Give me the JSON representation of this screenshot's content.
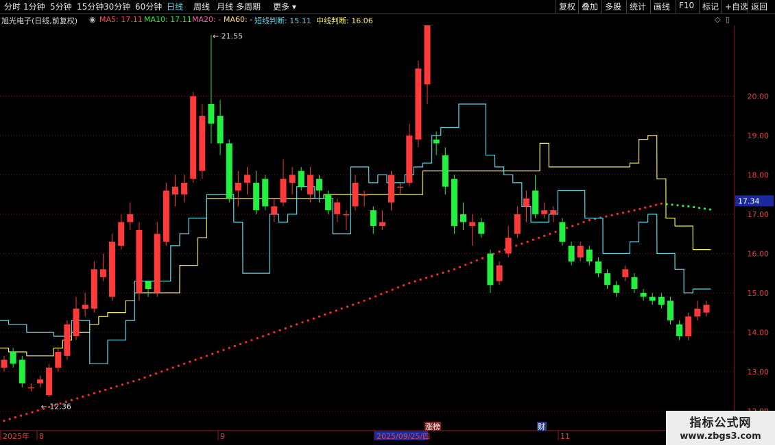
{
  "toolbar": {
    "left": [
      "分时",
      "1分钟",
      "5分钟",
      "15分钟",
      "30分钟",
      "60分钟",
      "日线",
      "周线",
      "月线",
      "多周期",
      "更多"
    ],
    "active": "日线",
    "right": [
      "复权",
      "叠加",
      "多股",
      "统计",
      "画线",
      "F10",
      "标记",
      "+自选",
      "返回"
    ]
  },
  "info": {
    "stock": "旭光电子(日线,前复权)",
    "ma5": "MA5: 17.11",
    "ma10": "MA10: 17.11",
    "ma20": "MA20: -",
    "ma60": "MA60: -",
    "short": "短线判断: 15.11",
    "mid": "中线判断: 16.06"
  },
  "colors": {
    "up": "#ff3a3a",
    "down": "#21f03e",
    "cyan": "#5fd9e6",
    "yellow": "#f5ee55",
    "dot": "#ff2a2a",
    "grid": "#6e1414"
  },
  "chart_data": {
    "type": "candlestick",
    "ylim": [
      11.5,
      21.8
    ],
    "y_ticks": [
      "12.00",
      "13.00",
      "14.00",
      "15.00",
      "16.00",
      "17.00",
      "18.00",
      "19.00",
      "20.00"
    ],
    "current_price_label": "17.34",
    "current_price": 17.34,
    "x_labels": [
      "2025年",
      "8",
      "9",
      "2025/09/25/四",
      "11"
    ],
    "event_markers": [
      "涨榜",
      "财"
    ],
    "annotations": {
      "high": "21.55",
      "low": "12.36"
    },
    "candles": [
      [
        13.1,
        13.3,
        13.0,
        13.4
      ],
      [
        13.5,
        13.2,
        13.1,
        13.6
      ],
      [
        13.3,
        12.7,
        12.6,
        13.4
      ],
      [
        12.6,
        12.6,
        12.5,
        12.7
      ],
      [
        12.7,
        12.8,
        12.6,
        12.9
      ],
      [
        12.4,
        13.1,
        12.36,
        13.2
      ],
      [
        13.1,
        13.5,
        13.0,
        13.6
      ],
      [
        13.4,
        14.2,
        13.3,
        14.3
      ],
      [
        13.9,
        14.6,
        13.8,
        14.9
      ],
      [
        14.6,
        14.7,
        14.4,
        15.0
      ],
      [
        14.6,
        15.6,
        14.5,
        15.8
      ],
      [
        15.4,
        15.6,
        15.3,
        16.0
      ],
      [
        14.9,
        16.3,
        14.8,
        16.5
      ],
      [
        16.2,
        16.8,
        16.1,
        17.0
      ],
      [
        16.8,
        17.0,
        16.6,
        17.3
      ],
      [
        15.0,
        16.6,
        14.8,
        16.8
      ],
      [
        15.3,
        15.1,
        14.9,
        15.3
      ],
      [
        15.0,
        16.5,
        14.9,
        16.8
      ],
      [
        16.3,
        17.6,
        16.2,
        17.8
      ],
      [
        17.5,
        17.7,
        17.2,
        18.0
      ],
      [
        17.5,
        17.8,
        17.3,
        18.0
      ],
      [
        17.9,
        20.0,
        17.8,
        20.1
      ],
      [
        18.1,
        19.5,
        17.9,
        19.8
      ],
      [
        19.8,
        19.3,
        18.8,
        21.55
      ],
      [
        19.5,
        18.8,
        18.5,
        19.9
      ],
      [
        18.8,
        17.4,
        17.3,
        18.9
      ],
      [
        17.6,
        17.8,
        17.2,
        18.1
      ],
      [
        17.8,
        18.0,
        17.5,
        18.2
      ],
      [
        17.8,
        17.1,
        17.0,
        18.1
      ],
      [
        17.9,
        17.2,
        17.1,
        18.0
      ],
      [
        17.0,
        17.2,
        16.8,
        17.4
      ],
      [
        17.3,
        17.9,
        17.2,
        18.4
      ],
      [
        17.8,
        18.0,
        17.5,
        18.2
      ],
      [
        18.1,
        17.7,
        17.6,
        18.2
      ],
      [
        17.5,
        18.0,
        17.3,
        18.2
      ],
      [
        17.9,
        17.6,
        17.3,
        18.0
      ],
      [
        17.5,
        17.1,
        17.0,
        17.6
      ],
      [
        17.0,
        17.3,
        16.8,
        17.4
      ],
      [
        17.0,
        17.0,
        16.6,
        17.1
      ],
      [
        17.2,
        17.8,
        17.1,
        18.0
      ],
      [
        17.5,
        17.5,
        17.2,
        17.6
      ],
      [
        17.1,
        16.7,
        16.5,
        17.2
      ],
      [
        16.7,
        16.8,
        16.6,
        17.1
      ],
      [
        17.3,
        18.0,
        17.1,
        18.1
      ],
      [
        17.7,
        17.7,
        17.5,
        17.8
      ],
      [
        17.8,
        19.0,
        17.7,
        19.3
      ],
      [
        18.9,
        20.7,
        18.7,
        20.9
      ],
      [
        20.3,
        22.0,
        19.8,
        22.3
      ],
      [
        18.9,
        18.8,
        18.5,
        19.1
      ],
      [
        18.5,
        17.7,
        17.5,
        18.7
      ],
      [
        17.9,
        16.7,
        16.5,
        18.0
      ],
      [
        17.0,
        16.8,
        16.6,
        17.3
      ],
      [
        16.7,
        16.8,
        16.2,
        17.0
      ],
      [
        16.8,
        16.5,
        16.4,
        16.9
      ],
      [
        16.0,
        15.2,
        15.0,
        16.1
      ],
      [
        15.3,
        15.7,
        15.2,
        15.8
      ],
      [
        16.0,
        16.4,
        15.9,
        16.7
      ],
      [
        16.5,
        17.0,
        16.4,
        17.2
      ],
      [
        17.2,
        17.4,
        16.8,
        17.6
      ],
      [
        17.6,
        17.0,
        16.9,
        18.0
      ],
      [
        17.0,
        17.1,
        16.9,
        17.3
      ],
      [
        17.0,
        17.1,
        16.8,
        17.2
      ],
      [
        16.8,
        16.3,
        16.2,
        16.9
      ],
      [
        16.2,
        15.8,
        15.7,
        16.3
      ],
      [
        15.9,
        16.2,
        15.8,
        16.3
      ],
      [
        16.1,
        15.8,
        15.7,
        16.2
      ],
      [
        15.8,
        15.5,
        15.4,
        15.9
      ],
      [
        15.5,
        15.2,
        15.1,
        15.6
      ],
      [
        15.2,
        15.0,
        14.9,
        15.3
      ],
      [
        15.4,
        15.6,
        15.3,
        15.7
      ],
      [
        15.4,
        15.1,
        15.0,
        15.5
      ],
      [
        15.0,
        14.9,
        14.8,
        15.1
      ],
      [
        14.9,
        14.8,
        14.7,
        15.0
      ],
      [
        14.9,
        14.7,
        14.6,
        15.0
      ],
      [
        14.8,
        14.3,
        14.2,
        14.9
      ],
      [
        14.2,
        13.9,
        13.8,
        14.3
      ],
      [
        13.9,
        14.4,
        13.8,
        14.5
      ],
      [
        14.4,
        14.6,
        14.3,
        14.8
      ],
      [
        14.5,
        14.7,
        14.4,
        14.8
      ]
    ],
    "short_line": [
      14.3,
      14.2,
      14.2,
      14.0,
      14.0,
      14.0,
      13.9,
      13.9,
      14.3,
      14.3,
      13.2,
      13.2,
      13.8,
      13.8,
      14.3,
      15.3,
      15.3,
      15.3,
      15.3,
      16.2,
      16.5,
      16.9,
      16.9,
      17.5,
      17.5,
      17.5,
      16.8,
      15.5,
      15.5,
      15.5,
      17.0,
      16.8,
      17.0,
      17.7,
      17.7,
      17.4,
      17.4,
      16.5,
      16.5,
      18.2,
      18.2,
      17.8,
      18.0,
      17.8,
      17.8,
      18.0,
      18.2,
      18.3,
      19.0,
      19.2,
      19.2,
      19.8,
      19.8,
      19.8,
      18.5,
      18.2,
      18.0,
      17.8,
      17.2,
      16.8,
      16.8,
      17.0,
      17.6,
      17.6,
      17.6,
      16.9,
      16.9,
      16.0,
      16.0,
      16.0,
      16.3,
      16.8,
      17.0,
      16.0,
      16.0,
      15.6,
      15.0,
      15.1,
      15.1
    ],
    "mid_line": [
      13.6,
      13.5,
      13.5,
      13.4,
      13.4,
      13.4,
      13.6,
      13.8,
      14.0,
      14.0,
      14.2,
      14.4,
      14.5,
      14.5,
      14.8,
      15.0,
      15.0,
      15.0,
      15.0,
      15.0,
      15.7,
      15.7,
      16.4,
      17.4,
      17.4,
      17.4,
      17.4,
      17.4,
      17.4,
      17.4,
      17.4,
      17.4,
      17.4,
      17.4,
      17.4,
      17.4,
      17.5,
      17.5,
      17.5,
      17.5,
      17.5,
      17.5,
      17.5,
      17.5,
      17.5,
      17.5,
      17.5,
      18.1,
      18.1,
      18.1,
      18.1,
      18.1,
      18.1,
      18.1,
      18.1,
      18.1,
      18.1,
      18.1,
      18.1,
      18.1,
      18.8,
      18.2,
      18.2,
      18.2,
      18.2,
      18.2,
      18.2,
      18.2,
      18.2,
      18.2,
      18.3,
      18.9,
      19.0,
      17.9,
      16.9,
      16.7,
      16.7,
      16.1,
      16.1
    ],
    "dots": [
      [
        0,
        11.75
      ],
      [
        5,
        12.1
      ],
      [
        10,
        12.45
      ],
      [
        15,
        12.8
      ],
      [
        20,
        13.2
      ],
      [
        25,
        13.6
      ],
      [
        30,
        14.0
      ],
      [
        35,
        14.4
      ],
      [
        40,
        14.8
      ],
      [
        45,
        15.25
      ],
      [
        50,
        15.6
      ],
      [
        55,
        16.05
      ],
      [
        60,
        16.45
      ],
      [
        65,
        16.85
      ],
      [
        70,
        17.1
      ],
      [
        73,
        17.27
      ],
      [
        76,
        17.2
      ],
      [
        79,
        17.1
      ]
    ]
  }
}
